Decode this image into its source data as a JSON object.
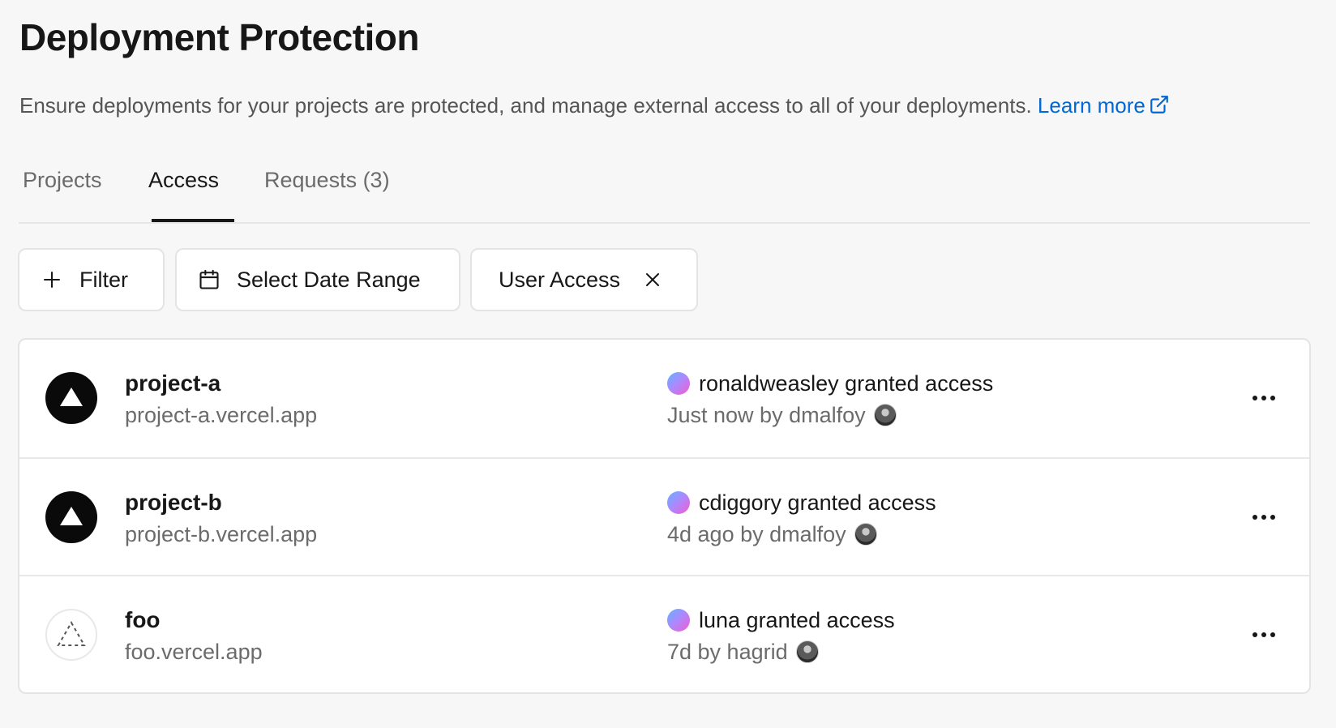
{
  "header": {
    "title": "Deployment Protection",
    "description": "Ensure deployments for your projects are protected, and manage external access to all of your deployments.",
    "learn_more": "Learn more"
  },
  "tabs": [
    {
      "label": "Projects",
      "active": false
    },
    {
      "label": "Access",
      "active": true
    },
    {
      "label": "Requests (3)",
      "active": false
    }
  ],
  "toolbar": {
    "filter_label": "Filter",
    "date_range_label": "Select Date Range",
    "active_filter_label": "User Access"
  },
  "rows": [
    {
      "project": "project-a",
      "domain": "project-a.vercel.app",
      "logo": "vercel-triangle-filled",
      "grant": "ronaldweasley granted access",
      "meta": "Just now by dmalfoy"
    },
    {
      "project": "project-b",
      "domain": "project-b.vercel.app",
      "logo": "vercel-triangle-filled",
      "grant": "cdiggory granted access",
      "meta": "4d ago by dmalfoy"
    },
    {
      "project": "foo",
      "domain": "foo.vercel.app",
      "logo": "vercel-triangle-dashed",
      "grant": "luna granted access",
      "meta": "7d by hagrid"
    }
  ],
  "colors": {
    "link": "#0068d6",
    "text": "#171717",
    "muted": "#6b6b6b",
    "border": "#e4e4e4"
  }
}
